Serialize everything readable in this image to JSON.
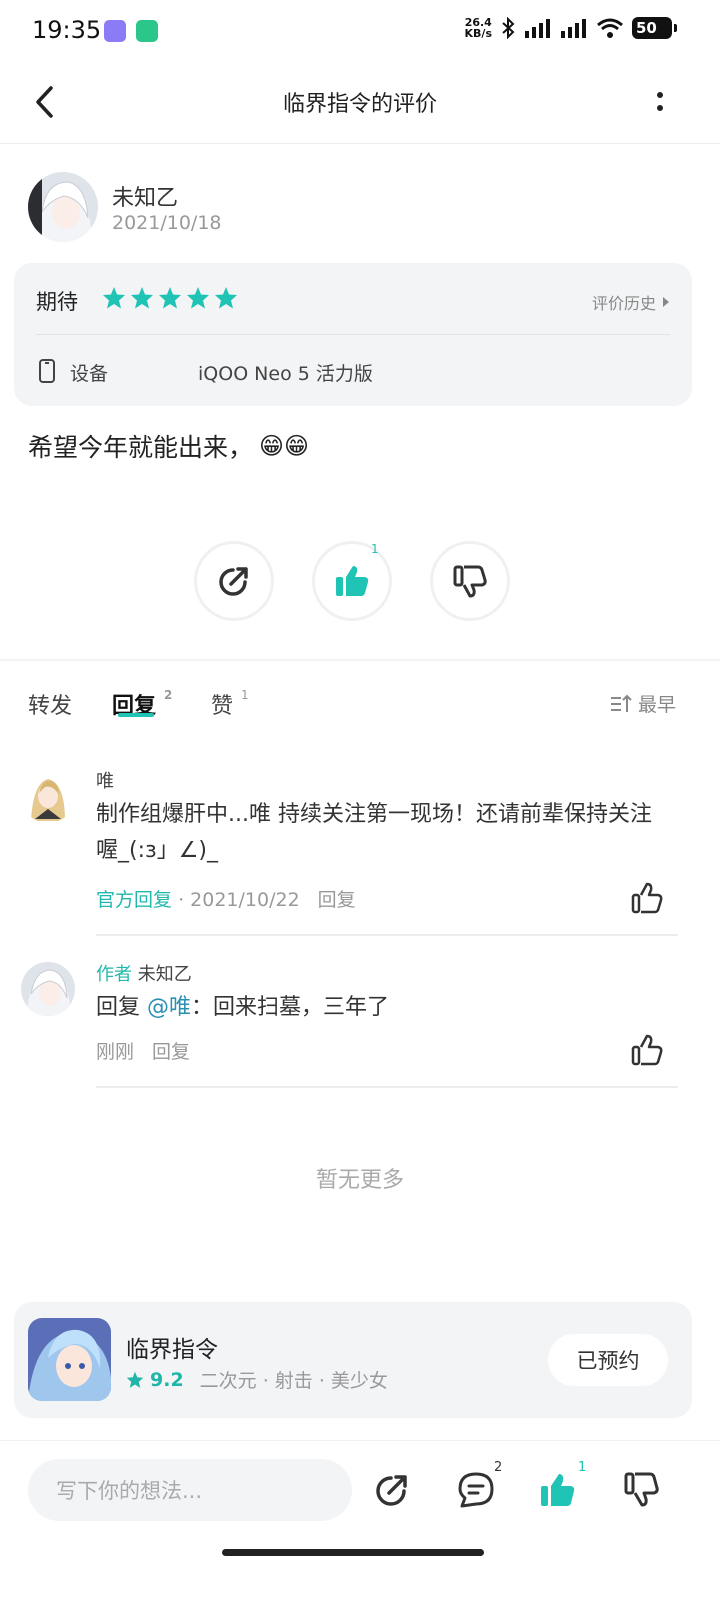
{
  "status_bar": {
    "time": "19:35",
    "net_speed_value": "26.4",
    "net_speed_unit": "KB/s",
    "battery": "50",
    "icons": [
      "app-icon-purple",
      "app-icon-green",
      "bluetooth-icon",
      "signal-icon",
      "signal-icon",
      "wifi-icon",
      "battery-icon"
    ]
  },
  "header": {
    "title": "临界指令的评价"
  },
  "review": {
    "author": "未知乙",
    "date": "2021/10/18",
    "rating_label": "期待",
    "stars": 5,
    "history_label": "评价历史",
    "device_label": "设备",
    "device_value": "iQOO Neo 5 活力版",
    "text": "希望今年就能出来，",
    "emoji": "😁😁",
    "like_count": "1"
  },
  "tabs": {
    "forward": "转发",
    "reply": "回复",
    "reply_count": "2",
    "like": "赞",
    "like_count": "1",
    "sort_label": "最早"
  },
  "comments": [
    {
      "name": "唯",
      "body": "制作组爆肝中...唯 持续关注第一现场！还请前辈保持关注喔_(:з」∠)_",
      "badge": "官方回复",
      "date": "· 2021/10/22",
      "reply_label": "回复"
    },
    {
      "author_tag": "作者",
      "name": "未知乙",
      "reply_prefix": "回复",
      "mention": "@唯",
      "body": "：回来扫墓，三年了",
      "time": "刚刚",
      "reply_label": "回复"
    }
  ],
  "no_more": "暂无更多",
  "game": {
    "name": "临界指令",
    "score": "9.2",
    "tags": "二次元 · 射击 · 美少女",
    "button": "已预约"
  },
  "bottom_bar": {
    "placeholder": "写下你的想法...",
    "comment_count": "2",
    "like_count": "1"
  },
  "colors": {
    "accent": "#1fc4b4",
    "card_bg": "#f3f4f6"
  }
}
